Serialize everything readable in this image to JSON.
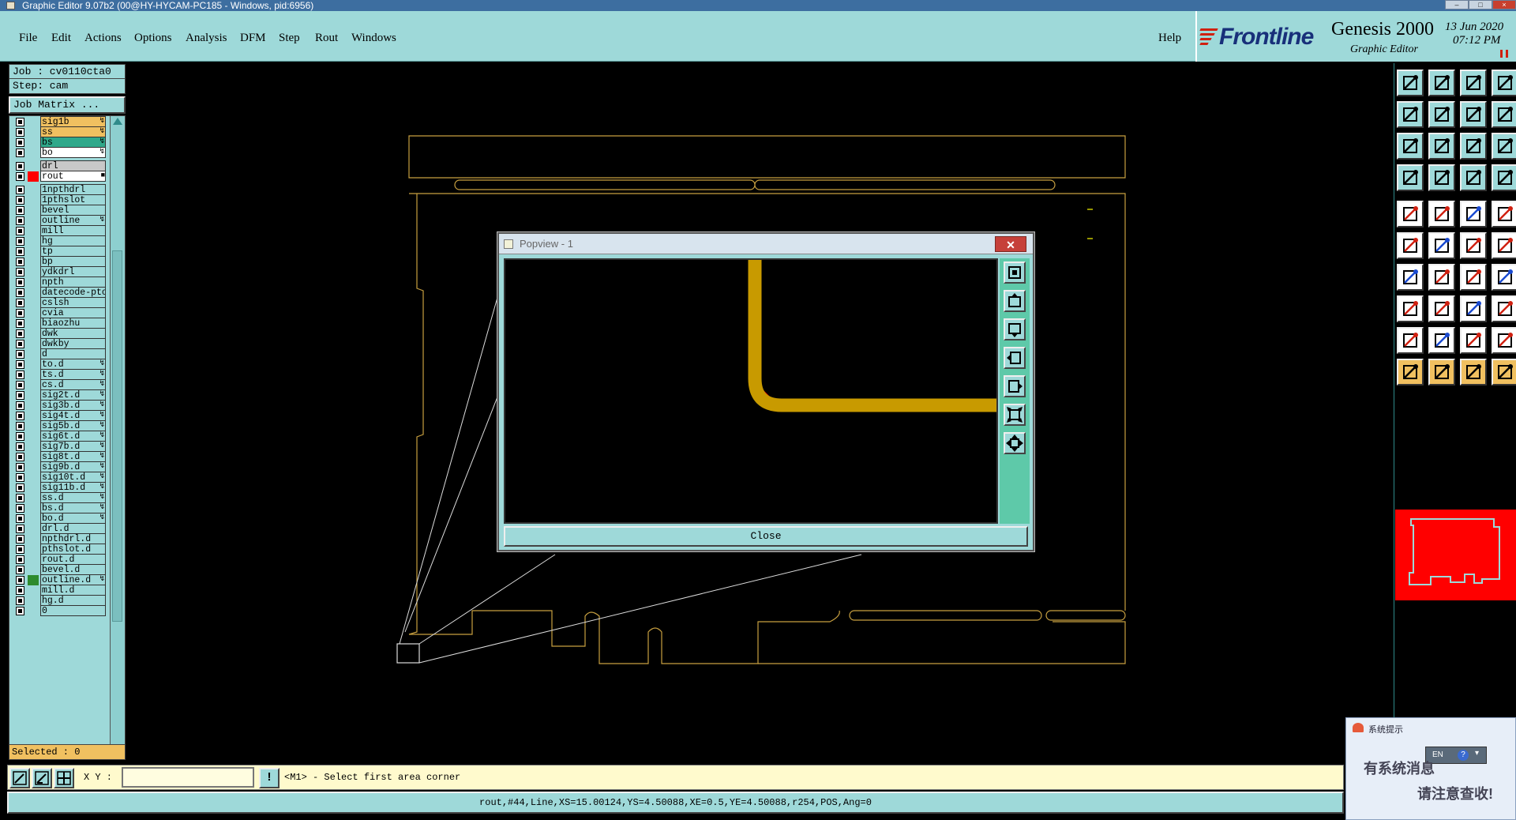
{
  "window": {
    "title": "Graphic Editor 9.07b2 (00@HY-HYCAM-PC185 - Windows, pid:6956)",
    "min": "–",
    "max": "□",
    "close": "×"
  },
  "menu": {
    "items": [
      "File",
      "Edit",
      "Actions",
      "Options",
      "Analysis",
      "DFM",
      "Step",
      "Rout",
      "Windows"
    ],
    "help": "Help"
  },
  "brand": {
    "logo": "Frontline",
    "product": "Genesis 2000",
    "subtitle": "Graphic Editor",
    "date": "13 Jun 2020",
    "time": "07:12 PM"
  },
  "job": {
    "job_label": "Job : cv0110cta0",
    "step_label": "Step: cam",
    "matrix_button": "Job Matrix ..."
  },
  "layers": [
    {
      "name": "sig1b",
      "color": "#f0c060",
      "flag": "↯",
      "swatch": ""
    },
    {
      "name": "ss",
      "color": "#f0c060",
      "flag": "↯",
      "swatch": ""
    },
    {
      "name": "bs",
      "color": "#2fa88a",
      "flag": "↯",
      "swatch": ""
    },
    {
      "name": "bo",
      "color": "#ffffff",
      "flag": "↯",
      "swatch": ""
    },
    {
      "name": "drl",
      "color": "#c8c8c8",
      "flag": "",
      "swatch": "",
      "gap": true
    },
    {
      "name": "rout",
      "color": "#ffffff",
      "flag": "■",
      "swatch": "#ff0000"
    },
    {
      "name": "1npthdrl",
      "color": "#9ed9d9",
      "flag": "",
      "swatch": "",
      "gap": true
    },
    {
      "name": "1pthslot",
      "color": "#9ed9d9",
      "flag": "",
      "swatch": ""
    },
    {
      "name": "bevel",
      "color": "#9ed9d9",
      "flag": "",
      "swatch": ""
    },
    {
      "name": "outline",
      "color": "#9ed9d9",
      "flag": "↯",
      "swatch": ""
    },
    {
      "name": "mill",
      "color": "#9ed9d9",
      "flag": "",
      "swatch": ""
    },
    {
      "name": "hg",
      "color": "#9ed9d9",
      "flag": "",
      "swatch": ""
    },
    {
      "name": "tp",
      "color": "#9ed9d9",
      "flag": "",
      "swatch": ""
    },
    {
      "name": "bp",
      "color": "#9ed9d9",
      "flag": "",
      "swatch": ""
    },
    {
      "name": "ydkdrl",
      "color": "#9ed9d9",
      "flag": "",
      "swatch": ""
    },
    {
      "name": "npth",
      "color": "#9ed9d9",
      "flag": "",
      "swatch": ""
    },
    {
      "name": "datecode-pto",
      "color": "#9ed9d9",
      "flag": "",
      "swatch": ""
    },
    {
      "name": "cslsh",
      "color": "#9ed9d9",
      "flag": "",
      "swatch": ""
    },
    {
      "name": "cvia",
      "color": "#9ed9d9",
      "flag": "",
      "swatch": ""
    },
    {
      "name": "biaozhu",
      "color": "#9ed9d9",
      "flag": "",
      "swatch": ""
    },
    {
      "name": "dwk",
      "color": "#9ed9d9",
      "flag": "",
      "swatch": ""
    },
    {
      "name": "dwkby",
      "color": "#9ed9d9",
      "flag": "",
      "swatch": ""
    },
    {
      "name": "d",
      "color": "#9ed9d9",
      "flag": "",
      "swatch": ""
    },
    {
      "name": "to.d",
      "color": "#9ed9d9",
      "flag": "↯",
      "swatch": ""
    },
    {
      "name": "ts.d",
      "color": "#9ed9d9",
      "flag": "↯",
      "swatch": ""
    },
    {
      "name": "cs.d",
      "color": "#9ed9d9",
      "flag": "↯",
      "swatch": ""
    },
    {
      "name": "sig2t.d",
      "color": "#9ed9d9",
      "flag": "↯",
      "swatch": ""
    },
    {
      "name": "sig3b.d",
      "color": "#9ed9d9",
      "flag": "↯",
      "swatch": ""
    },
    {
      "name": "sig4t.d",
      "color": "#9ed9d9",
      "flag": "↯",
      "swatch": ""
    },
    {
      "name": "sig5b.d",
      "color": "#9ed9d9",
      "flag": "↯",
      "swatch": ""
    },
    {
      "name": "sig6t.d",
      "color": "#9ed9d9",
      "flag": "↯",
      "swatch": ""
    },
    {
      "name": "sig7b.d",
      "color": "#9ed9d9",
      "flag": "↯",
      "swatch": ""
    },
    {
      "name": "sig8t.d",
      "color": "#9ed9d9",
      "flag": "↯",
      "swatch": ""
    },
    {
      "name": "sig9b.d",
      "color": "#9ed9d9",
      "flag": "↯",
      "swatch": ""
    },
    {
      "name": "sig10t.d",
      "color": "#9ed9d9",
      "flag": "↯",
      "swatch": ""
    },
    {
      "name": "sig11b.d",
      "color": "#9ed9d9",
      "flag": "↯",
      "swatch": ""
    },
    {
      "name": "ss.d",
      "color": "#9ed9d9",
      "flag": "↯",
      "swatch": ""
    },
    {
      "name": "bs.d",
      "color": "#9ed9d9",
      "flag": "↯",
      "swatch": ""
    },
    {
      "name": "bo.d",
      "color": "#9ed9d9",
      "flag": "↯",
      "swatch": ""
    },
    {
      "name": "drl.d",
      "color": "#9ed9d9",
      "flag": "",
      "swatch": ""
    },
    {
      "name": "npthdrl.d",
      "color": "#9ed9d9",
      "flag": "",
      "swatch": ""
    },
    {
      "name": "pthslot.d",
      "color": "#9ed9d9",
      "flag": "",
      "swatch": ""
    },
    {
      "name": "rout.d",
      "color": "#9ed9d9",
      "flag": "",
      "swatch": ""
    },
    {
      "name": "bevel.d",
      "color": "#9ed9d9",
      "flag": "",
      "swatch": ""
    },
    {
      "name": "outline.d",
      "color": "#9ed9d9",
      "flag": "↯",
      "swatch": "#2e8b2e"
    },
    {
      "name": "mill.d",
      "color": "#9ed9d9",
      "flag": "",
      "swatch": ""
    },
    {
      "name": "hg.d",
      "color": "#9ed9d9",
      "flag": "",
      "swatch": ""
    },
    {
      "name": "0",
      "color": "#9ed9d9",
      "flag": "",
      "swatch": ""
    }
  ],
  "selected_label": "Selected : 0",
  "popview": {
    "title": "Popview - 1",
    "close_x": "✕",
    "close_button": "Close"
  },
  "right_tools": [
    "send-to-back-icon",
    "bring-to-front-icon",
    "home-icon",
    "window-icon",
    "move-left-icon",
    "move-right-icon",
    "swap-icon",
    "snap-icon",
    "fit-vertical-icon",
    "fit-all-icon",
    "ratio-icon",
    "help-icon",
    "measure-icon",
    "probe-icon",
    "net-icon",
    "layers-icon",
    "pad-icon",
    "angle-icon",
    "ruler-icon",
    "dot-icon",
    "nodes-icon",
    "cross-icon",
    "vector-icon",
    "flag-icon",
    "line-icon",
    "pen-icon",
    "arc-icon",
    "text-f-icon",
    "box-point-icon",
    "minus-icon",
    "center-icon",
    "link-icon",
    "triangle-icon",
    "peak-icon",
    "arch-icon",
    "dual-arch-icon",
    "select-icon",
    "select-add-icon",
    "select-rotate-icon",
    "select-net-icon"
  ],
  "bottom": {
    "xy_label": "X Y :",
    "xy_value": "",
    "prompt_icon": "!",
    "prompt": "<M1> - Select first area corner",
    "status": "rout,#44,Line,XS=15.00124,YS=4.50088,XE=0.5,YE=4.50088,r254,POS,Ang=0"
  },
  "notify": {
    "title": "系统提示",
    "line1": "有系统消息",
    "line2": "请注意查收!",
    "lang": "EN",
    "lang_help": "?"
  },
  "colors": {
    "panel": "#9ed9d9",
    "outline": "#c8a040",
    "trace": "#c89a00",
    "red": "#ff0000",
    "green": "#2e8b2e"
  }
}
